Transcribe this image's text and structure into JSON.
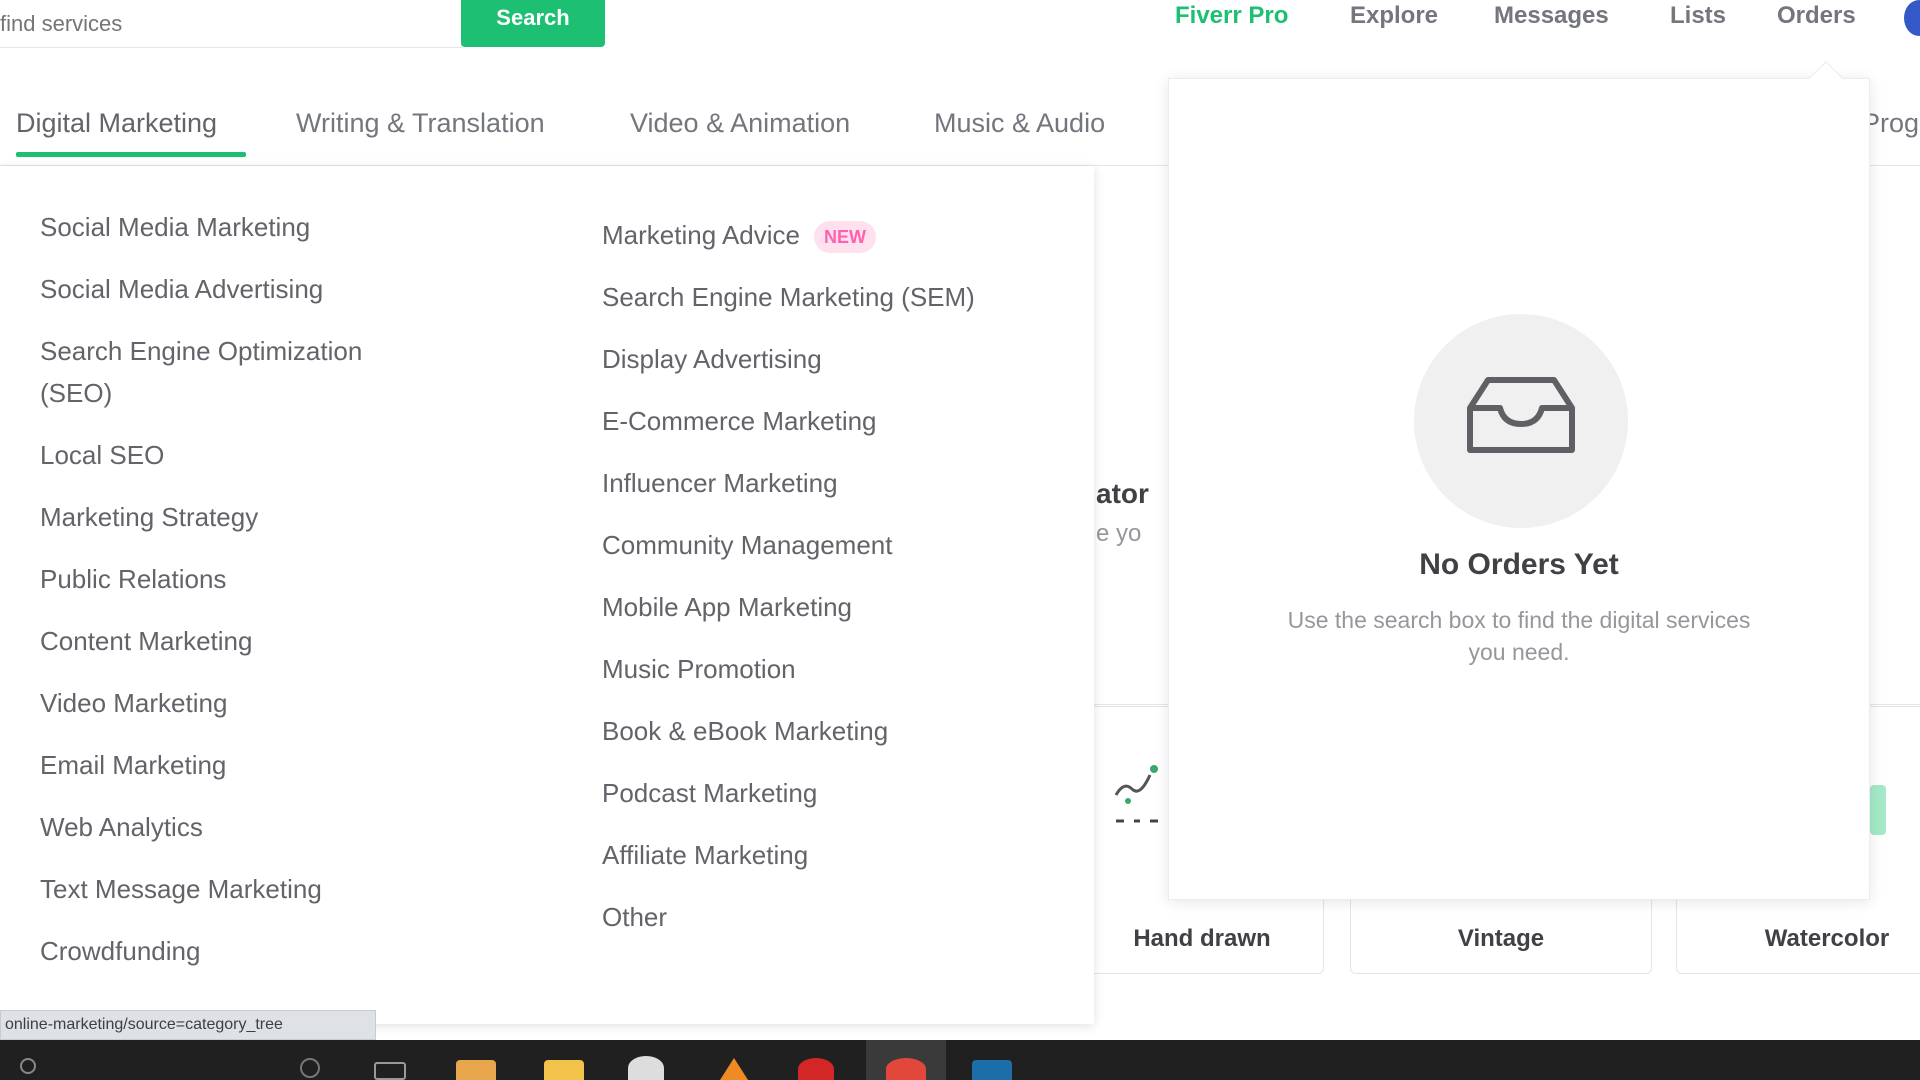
{
  "header": {
    "search_placeholder": "find services",
    "search_button": "Search",
    "nav": {
      "pro": "Fiverr Pro",
      "explore": "Explore",
      "messages": "Messages",
      "lists": "Lists",
      "orders": "Orders"
    }
  },
  "categories": {
    "tabs": [
      "Digital Marketing",
      "Writing & Translation",
      "Video & Animation",
      "Music & Audio"
    ],
    "more": "Prog"
  },
  "dropdown": {
    "column1": [
      "Social Media Marketing",
      "Social Media Advertising",
      "Search Engine Optimization (SEO)",
      "Local SEO",
      "Marketing Strategy",
      "Public Relations",
      "Content Marketing",
      "Video Marketing",
      "Email Marketing",
      "Web Analytics",
      "Text Message Marketing",
      "Crowdfunding"
    ],
    "column2": [
      "Marketing Advice",
      "Search Engine Marketing (SEM)",
      "Display Advertising",
      "E-Commerce Marketing",
      "Influencer Marketing",
      "Community Management",
      "Mobile App Marketing",
      "Music Promotion",
      "Book & eBook Marketing",
      "Podcast Marketing",
      "Affiliate Marketing",
      "Other"
    ],
    "new_badge": "NEW"
  },
  "orders_popover": {
    "title": "No Orders Yet",
    "description": "Use the search box to find the digital services you need."
  },
  "background": {
    "partial_title": "ator",
    "partial_sub": "e yo",
    "style_cards": [
      "Hand drawn",
      "Vintage",
      "Watercolor"
    ]
  },
  "status_url": "online-marketing/source=category_tree",
  "colors": {
    "brand_green": "#1dbf73",
    "new_badge_bg": "#ffe0ef",
    "new_badge_text": "#ff62ad"
  }
}
